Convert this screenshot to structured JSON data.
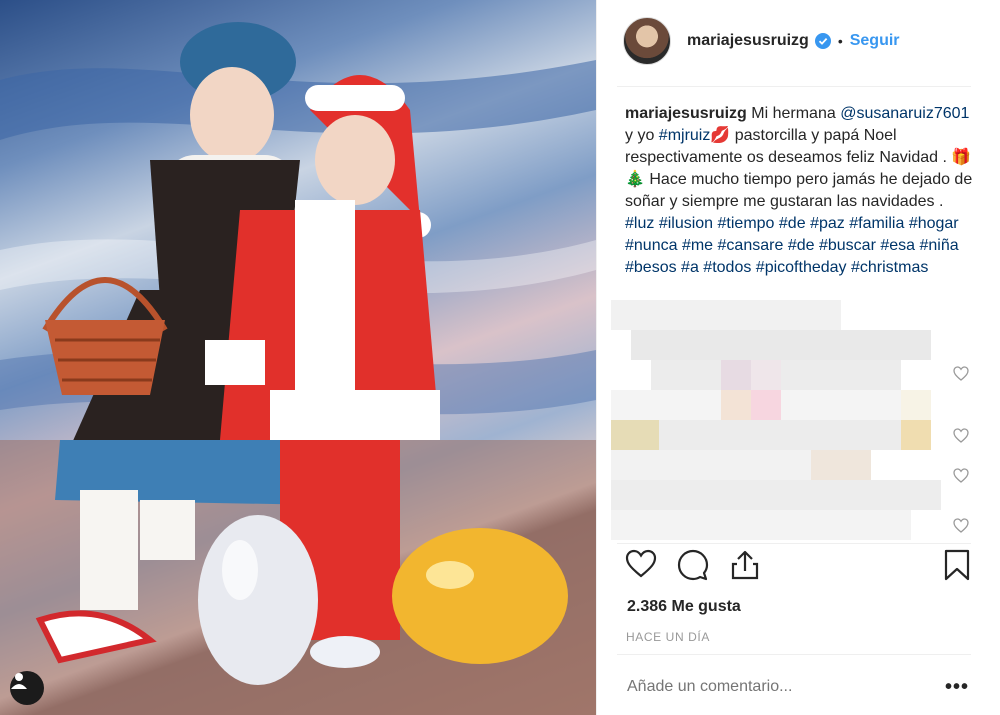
{
  "post": {
    "username": "mariajesusruizg",
    "separator": "•",
    "follow_label": "Seguir",
    "caption": {
      "author": "mariajesusruizg",
      "text_1": " Mi hermana ",
      "mention": "@susanaruiz7601",
      "text_2": " y yo ",
      "tag_mjruiz": "#mjruiz",
      "emoji_kiss": "💋",
      "text_3": " pastorcilla y papá Noel respectivamente os deseamos feliz Navidad . ",
      "emoji_gift": "🎁",
      "emoji_tree": "🎄",
      "text_4": " Hace mucho tiempo pero jamás he dejado de soñar y siempre me gustaran las navidades . ",
      "hashtags": [
        "#luz",
        "#ilusion",
        "#tiempo",
        "#de",
        "#paz",
        "#familia",
        "#hogar",
        "#nunca",
        "#me",
        "#cansare",
        "#de",
        "#buscar",
        "#esa",
        "#niña",
        "#besos",
        "#a",
        "#todos",
        "#picoftheday",
        "#christmas"
      ]
    },
    "likes": "2.386 Me gusta",
    "timestamp": "HACE UN DÍA",
    "comment_placeholder": "Añade un comentario...",
    "more_label": "•••"
  },
  "icons": {
    "verified": "verified-badge-icon",
    "like": "heart-icon",
    "comment": "comment-icon",
    "share": "share-icon",
    "save": "bookmark-icon",
    "user": "user-tag-icon"
  },
  "colors": {
    "link": "#3897f0",
    "hashtag": "#003569",
    "muted": "#999999",
    "text": "#262626"
  }
}
